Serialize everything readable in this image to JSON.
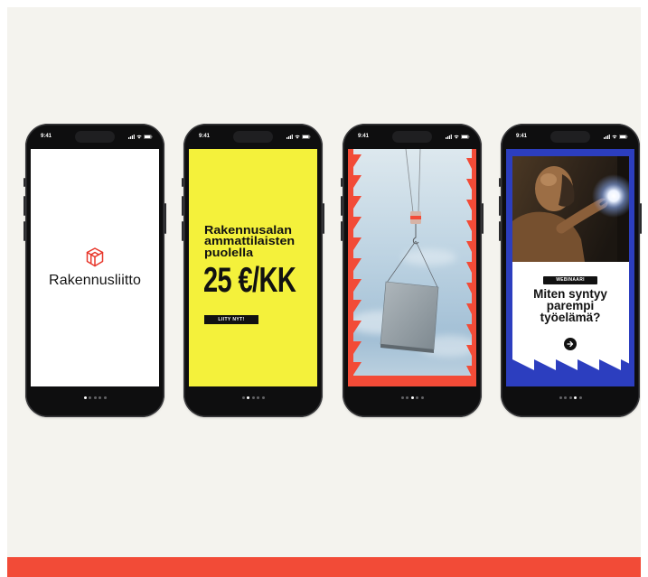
{
  "colors": {
    "page_background": "#f4f3ee",
    "accent_red": "#f24b37",
    "brand_yellow": "#f4f13b",
    "brand_blue": "#2c3ebf",
    "phone_body": "#0e0e0f",
    "ink": "#111111"
  },
  "status_bar": {
    "icons": [
      "signal-icon",
      "wifi-icon",
      "battery-icon"
    ]
  },
  "phones": [
    {
      "status_time": "9:41",
      "dot_count": 5,
      "active_dot": 1,
      "screen": {
        "logo_icon": "rakennusliitto-cube-logo-icon",
        "brand_name": "Rakennusliitto"
      }
    },
    {
      "status_time": "9:41",
      "dot_count": 5,
      "active_dot": 2,
      "screen": {
        "headline_lines": [
          "Rakennusalan",
          "ammattilaisten",
          "puolella"
        ],
        "price": "25 €/KK",
        "cta_label": "LIITY NYT!"
      }
    },
    {
      "status_time": "9:41",
      "dot_count": 5,
      "active_dot": 3
    },
    {
      "status_time": "9:41",
      "dot_count": 5,
      "active_dot": 4,
      "screen": {
        "badge": "WEBINAARI",
        "title_lines": [
          "Miten syntyy",
          "parempi",
          "työelämä?"
        ],
        "cta_icon": "arrow-right-icon"
      }
    }
  ]
}
